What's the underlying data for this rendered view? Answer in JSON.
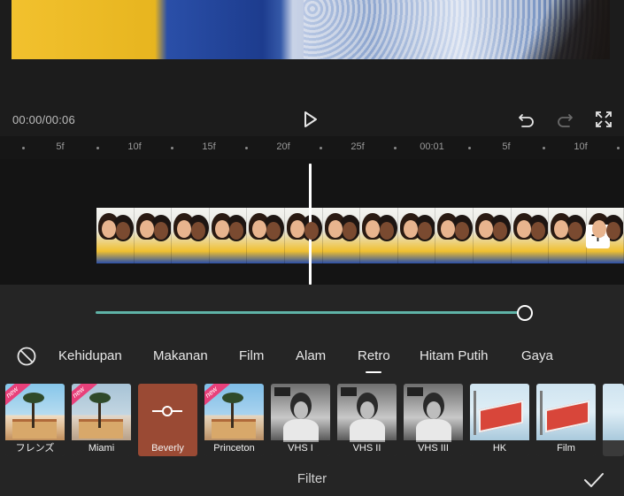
{
  "player": {
    "time": "00:00/00:06"
  },
  "timeline": {
    "ruler_labels": [
      "5f",
      "10f",
      "15f",
      "20f",
      "25f",
      "00:01",
      "5f",
      "10f"
    ]
  },
  "categories": {
    "items": [
      "Kehidupan",
      "Makanan",
      "Film",
      "Alam",
      "Retro",
      "Hitam Putih",
      "Gaya"
    ],
    "selected": "Retro"
  },
  "filters": [
    {
      "label": "フレンズ",
      "badge": "new"
    },
    {
      "label": "Miami",
      "badge": "new"
    },
    {
      "label": "Beverly",
      "badge": ""
    },
    {
      "label": "Princeton",
      "badge": "new"
    },
    {
      "label": "VHS I",
      "badge": ""
    },
    {
      "label": "VHS II",
      "badge": ""
    },
    {
      "label": "VHS III",
      "badge": ""
    },
    {
      "label": "HK",
      "badge": ""
    },
    {
      "label": "Film",
      "badge": ""
    }
  ],
  "panel": {
    "title": "Filter",
    "intensity_percent": 100
  },
  "colors": {
    "accent_teal": "#5fb3a7",
    "selected_filter": "#9a4a34",
    "badge_pink": "#e8407a"
  },
  "icons": {
    "play": "play-icon",
    "undo": "undo-icon",
    "redo": "redo-icon",
    "fullscreen": "fullscreen-icon",
    "add": "plus-icon",
    "none": "no-filter-icon",
    "confirm": "checkmark-icon",
    "adjust": "slider-adjust-icon"
  }
}
